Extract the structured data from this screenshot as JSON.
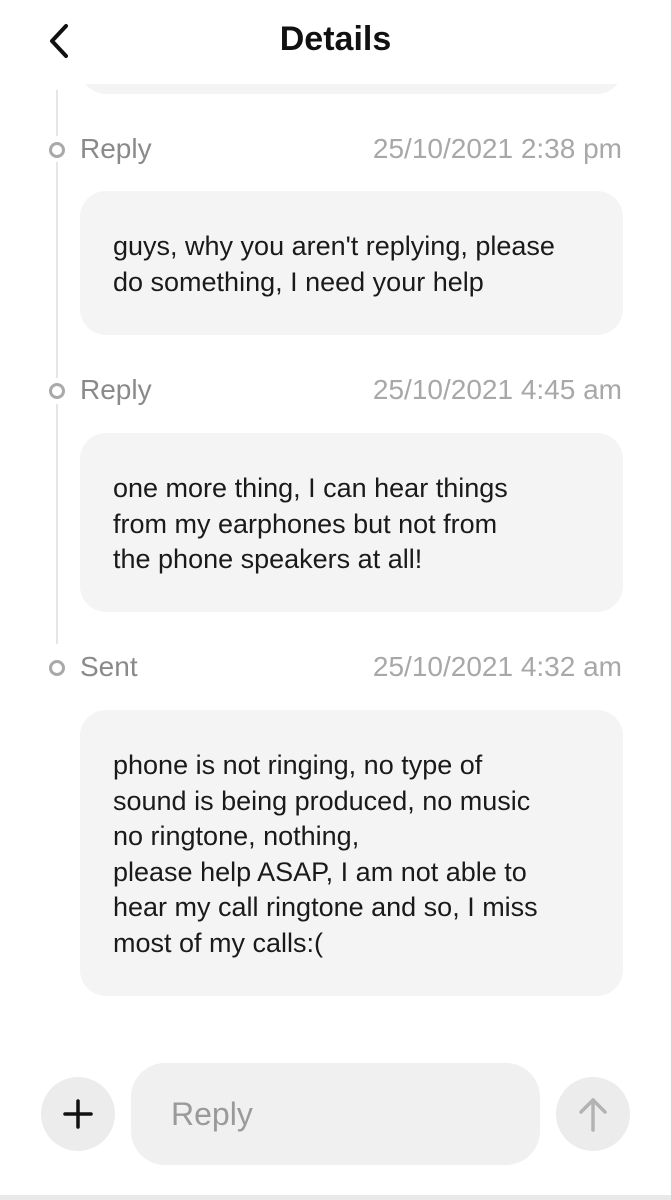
{
  "header": {
    "title": "Details",
    "back_icon": "chevron-left-icon"
  },
  "messages": [
    {
      "status": "Reply",
      "timestamp": "25/10/2021 2:38 pm",
      "text": "guys, why you aren't replying, please\ndo something, I need your help"
    },
    {
      "status": "Reply",
      "timestamp": "25/10/2021 4:45 am",
      "text": "one more thing, I can hear things\nfrom my earphones but not from\nthe phone speakers at all!"
    },
    {
      "status": "Sent",
      "timestamp": "25/10/2021 4:32 am",
      "text": "phone is not ringing, no type of\nsound is being produced, no music\nno ringtone, nothing,\nplease help ASAP, I am not able to\nhear my call ringtone and so, I miss\nmost of my calls:("
    }
  ],
  "composer": {
    "placeholder": "Reply",
    "value": "",
    "add_icon": "plus-icon",
    "send_icon": "arrow-up-icon"
  },
  "colors": {
    "bubble": "#f4f4f4",
    "label": "#8a8a8a",
    "timestamp": "#a8a8a8",
    "node": "#a9a9a9",
    "send_disabled": "#b3b3b3"
  }
}
